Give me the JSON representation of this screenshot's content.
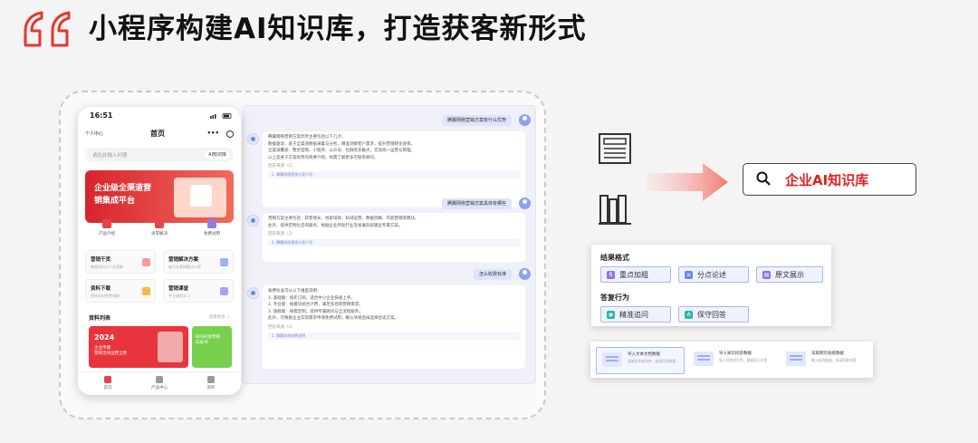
{
  "header": {
    "title": "小程序构建AI知识库，打造获客新形式"
  },
  "phone": {
    "time": "16:51",
    "nav_left": "个人中心",
    "nav_title": "首页",
    "nav_dots": "•••",
    "search_placeholder": "请在此输入问题",
    "ai_button": "AI知识库",
    "banner_line1": "企业级全渠道营",
    "banner_line2": "销集成平台",
    "icons": [
      {
        "label": "产品介绍",
        "color": "#e8434a"
      },
      {
        "label": "诉求解决",
        "color": "#e8434a"
      },
      {
        "label": "免费试用",
        "color": "#8e7ee6"
      }
    ],
    "cards": [
      {
        "title": "营销干货",
        "sub": "数据资料与干货获取",
        "color": "#f59a9a"
      },
      {
        "title": "营销解决方案",
        "sub": "各行业营销解决方案",
        "color": "#9fb3f2"
      },
      {
        "title": "资料下载",
        "sub": "营销资料免费领取",
        "color": "#f6b84b"
      },
      {
        "title": "营销课堂",
        "sub": "专业课程学习",
        "color": "#b49cf0"
      }
    ],
    "materials_title": "资料列表",
    "materials_more": "查看更多 >",
    "mat1_year": "2024",
    "mat1_l1": "企业传播",
    "mat1_l2": "营销活动运营全景",
    "mat2_l1": "B2B内容营销",
    "mat2_l2": "白皮书",
    "tabs": [
      "首页",
      "产品中心",
      "资料"
    ]
  },
  "chat": {
    "q1": "腾翼网络营销方案有什么优势",
    "a1": [
      "腾翼网络营销方案优势主要包括以下几点：",
      "数据驱动：基于全渠道数据采集与分析，精准洞察客户需求，提升营销转化效率。",
      "全渠道覆盖：整合官网、小程序、公众号、社群等多触点，实现统一运营与管理。",
      "以上是关于方案优势的简要介绍，如需了解更多可联系顾问。"
    ],
    "a1_ref": "回答来源（2）",
    "a1_link": "1. 腾翼网络营销方案介绍",
    "q2": "腾翼网络营销方案具体有哪些",
    "a2": [
      "营销方案主要包括：获客增长、线索培育、私域运营、数据洞察、内容营销等模块。",
      "此外，提供定制化咨询服务，根据企业所处行业及发展阶段输出专属方案。"
    ],
    "a2_ref": "回答来源（2）",
    "a2_link": "1. 腾翼网络营销方案介绍",
    "q3": "怎么收费标准",
    "a3": [
      "收费标准可从以下维度说明：",
      "1. 基础版：按年订阅，适合中小企业快速上手。",
      "2. 专业版：按模块组合计费，满足多场景营销需求。",
      "3. 旗舰版：按需定制，提供专属顾问与全流程服务。",
      "此外，可根据企业实际需求申请免费试用，确认效果后再选择合适方案。"
    ],
    "a3_ref": "回答来源（2）",
    "a3_link": "1. 腾翼网络收费说明"
  },
  "knowledge_base": {
    "label": "企业AI知识库"
  },
  "options": {
    "format_title": "结果格式",
    "format_chips": [
      {
        "label": "重点加粗",
        "glyph": "B",
        "color": "#8e72e6"
      },
      {
        "label": "分点论述",
        "glyph": "≡",
        "color": "#6d86e6"
      },
      {
        "label": "原文展示",
        "glyph": "▤",
        "color": "#8e72e6"
      }
    ],
    "behavior_title": "答复行为",
    "behavior_chips": [
      {
        "label": "精准追问",
        "glyph": "◉",
        "color": "#2bb5a6"
      },
      {
        "label": "保守回答",
        "glyph": "A",
        "color": "#2bb5a6"
      }
    ]
  },
  "import_cards": [
    {
      "title": "导入文本文档数据",
      "sub": "读取文本或文件，自动切分数据"
    },
    {
      "title": "导入知识问答数据",
      "sub": "导入问答对文件，直接用于问答"
    },
    {
      "title": "读取网页链接数据",
      "sub": "输入网页链接，自动抓取内容"
    }
  ]
}
